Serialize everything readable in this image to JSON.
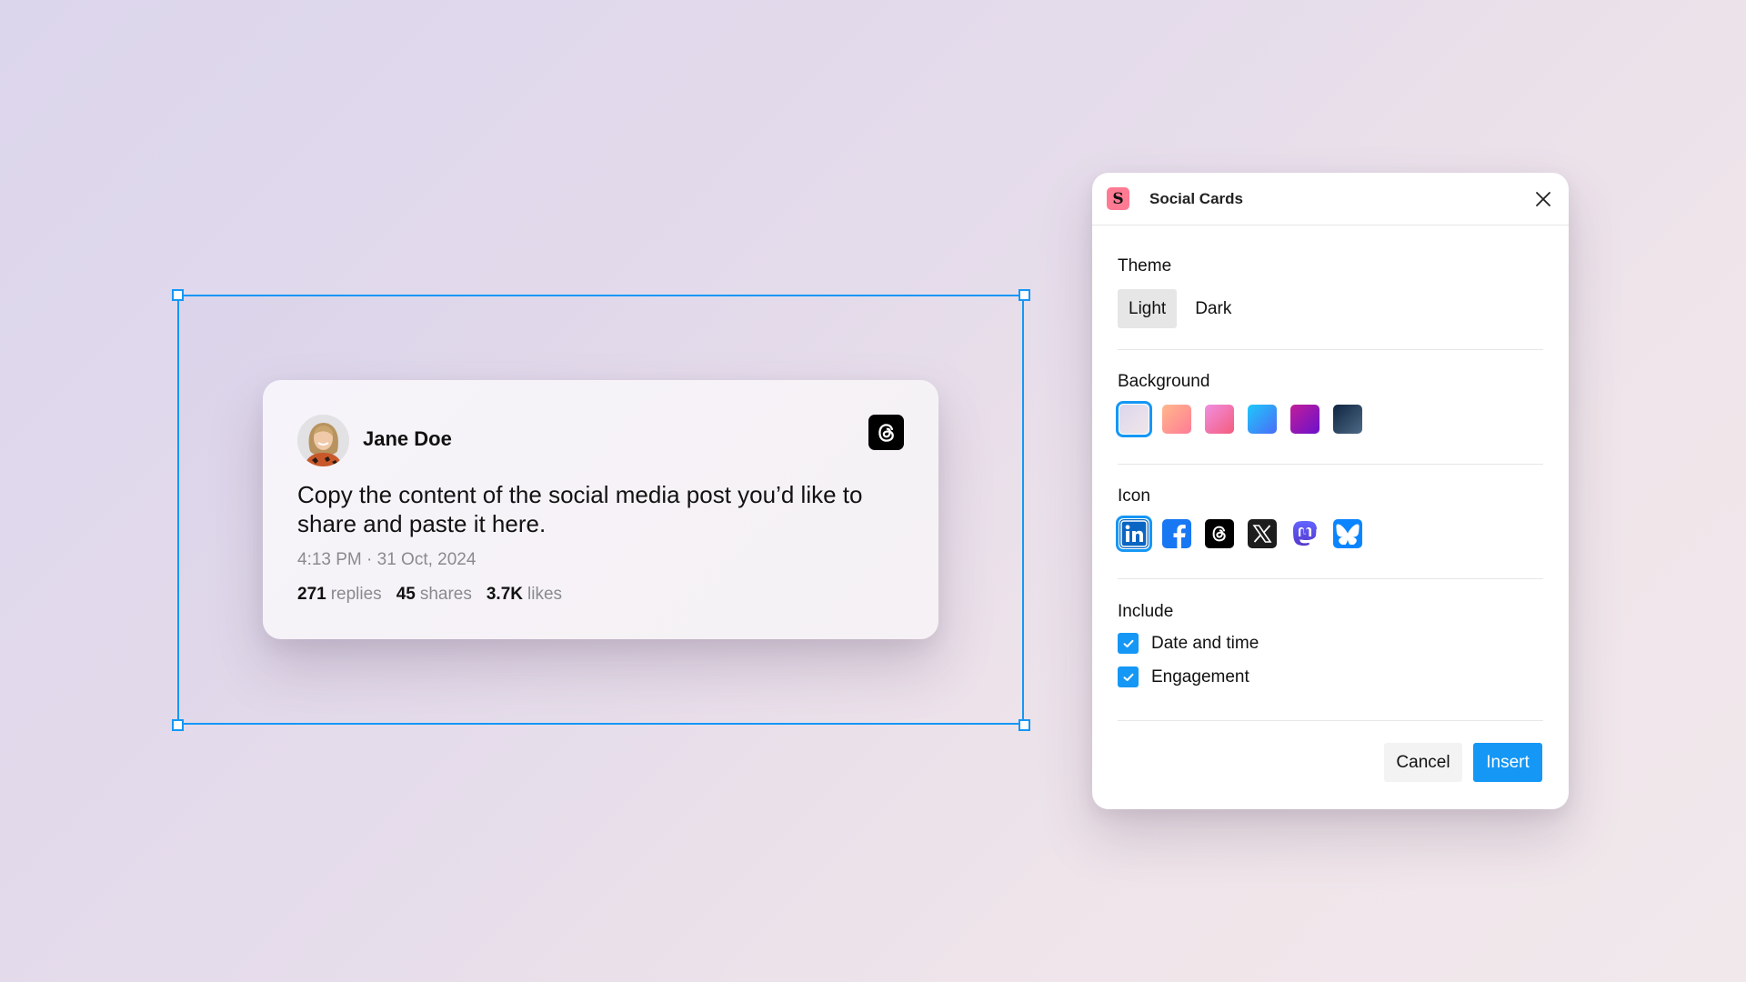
{
  "canvas": {
    "selection_frame": {
      "color": "#1597f5"
    }
  },
  "post_card": {
    "author_name": "Jane Doe",
    "platform_icon": "threads-icon",
    "text": "Copy the content of the social media post you’d like to share and paste it here.",
    "timestamp": "4:13 PM · 31 Oct, 2024",
    "stats": [
      {
        "value": "271",
        "label": "replies"
      },
      {
        "value": "45",
        "label": "shares"
      },
      {
        "value": "3.7K",
        "label": "likes"
      }
    ]
  },
  "dialog": {
    "app_logo_letter": "S",
    "app_logo_color": "#ff7a93",
    "title": "Social Cards",
    "close_icon": "close-icon",
    "theme": {
      "label": "Theme",
      "options": [
        "Light",
        "Dark"
      ],
      "selected": "Light"
    },
    "background": {
      "label": "Background",
      "swatches": [
        {
          "name": "lavender",
          "from": "#dcd6ec",
          "to": "#f0e6ea",
          "selected": true
        },
        {
          "name": "peach",
          "from": "#ffb88c",
          "to": "#ff7b95",
          "selected": false
        },
        {
          "name": "pink",
          "from": "#f08fe0",
          "to": "#f45c7d",
          "selected": false
        },
        {
          "name": "blue",
          "from": "#1fc8fa",
          "to": "#4a6cf7",
          "selected": false
        },
        {
          "name": "purple",
          "from": "#c21e9a",
          "to": "#6a11cb",
          "selected": false
        },
        {
          "name": "navy",
          "from": "#0f2440",
          "to": "#4d6a86",
          "selected": false
        }
      ]
    },
    "icon": {
      "label": "Icon",
      "options": [
        {
          "name": "linkedin",
          "selected": true
        },
        {
          "name": "facebook",
          "selected": false
        },
        {
          "name": "threads",
          "selected": false
        },
        {
          "name": "x",
          "selected": false
        },
        {
          "name": "mastodon",
          "selected": false
        },
        {
          "name": "bluesky",
          "selected": false
        }
      ]
    },
    "include": {
      "label": "Include",
      "options": [
        {
          "label": "Date and time",
          "checked": true
        },
        {
          "label": "Engagement",
          "checked": true
        }
      ]
    },
    "buttons": {
      "cancel": "Cancel",
      "insert": "Insert"
    },
    "accent_color": "#1597f5"
  }
}
